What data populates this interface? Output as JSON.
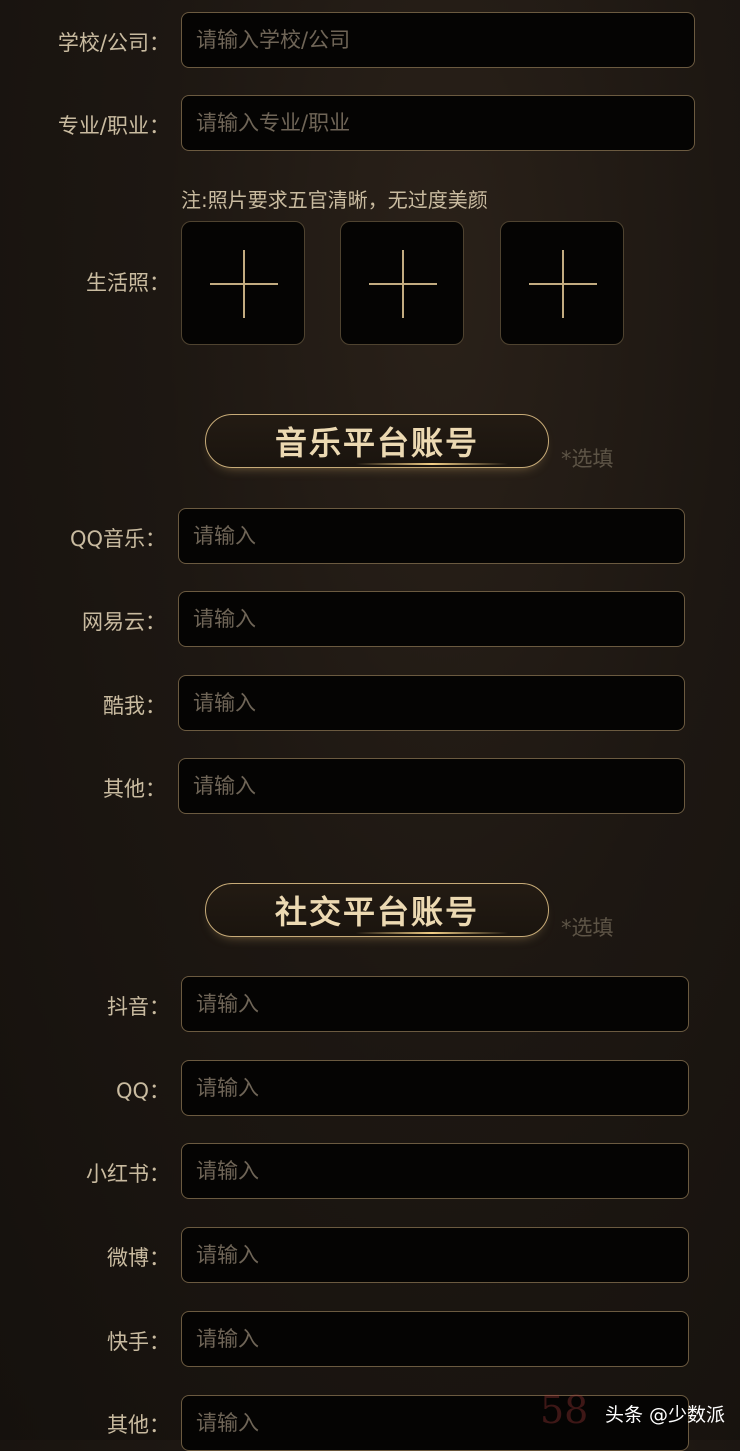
{
  "basic": {
    "school": {
      "label": "学校/公司：",
      "placeholder": "请输入学校/公司"
    },
    "major": {
      "label": "专业/职业：",
      "placeholder": "请输入专业/职业"
    },
    "photo_note": "注:照片要求五官清晰，无过度美颜",
    "photo_label": "生活照："
  },
  "music": {
    "title": "音乐平台账号",
    "optional": "*选填",
    "fields": [
      {
        "label": "QQ音乐：",
        "placeholder": "请输入"
      },
      {
        "label": "网易云：",
        "placeholder": "请输入"
      },
      {
        "label": "酷我：",
        "placeholder": "请输入"
      },
      {
        "label": "其他：",
        "placeholder": "请输入"
      }
    ]
  },
  "social": {
    "title": "社交平台账号",
    "optional": "*选填",
    "fields": [
      {
        "label": "抖音：",
        "placeholder": "请输入"
      },
      {
        "label": "QQ：",
        "placeholder": "请输入"
      },
      {
        "label": "小红书：",
        "placeholder": "请输入"
      },
      {
        "label": "微博：",
        "placeholder": "请输入"
      },
      {
        "label": "快手：",
        "placeholder": "请输入"
      },
      {
        "label": "其他：",
        "placeholder": "请输入"
      }
    ]
  },
  "watermark": {
    "text": "头条 @少数派",
    "logo": "58"
  }
}
